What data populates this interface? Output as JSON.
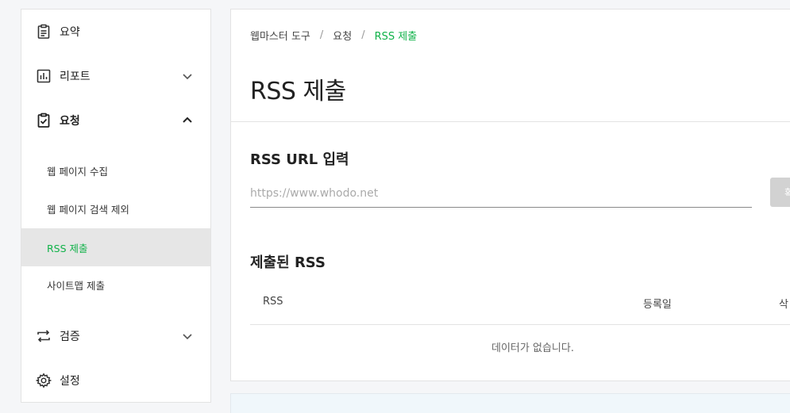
{
  "sidebar": {
    "items": [
      {
        "label": "요약",
        "icon": "clipboard-icon"
      },
      {
        "label": "리포트",
        "icon": "bar-chart-icon"
      },
      {
        "label": "요청",
        "icon": "clipboard-check-icon"
      },
      {
        "label": "검증",
        "icon": "repeat-icon"
      },
      {
        "label": "설정",
        "icon": "gear-icon"
      }
    ],
    "subitems": [
      {
        "label": "웹 페이지 수집"
      },
      {
        "label": "웹 페이지 검색 제외"
      },
      {
        "label": "RSS 제출"
      },
      {
        "label": "사이트맵 제출"
      }
    ]
  },
  "breadcrumb": {
    "items": [
      "웹마스터 도구",
      "요청",
      "RSS 제출"
    ],
    "separator": "/"
  },
  "page": {
    "title": "RSS 제출"
  },
  "rss_input": {
    "section_title": "RSS URL 입력",
    "placeholder": "https://www.whodo.net",
    "button_label": "확"
  },
  "submitted": {
    "section_title": "제출된 RSS",
    "columns": [
      "RSS",
      "등록일",
      "삭"
    ],
    "empty_message": "데이터가 없습니다."
  },
  "colors": {
    "accent": "#10b249",
    "active_bg": "#e6e6e6",
    "button_disabled": "#d2d2d2"
  }
}
